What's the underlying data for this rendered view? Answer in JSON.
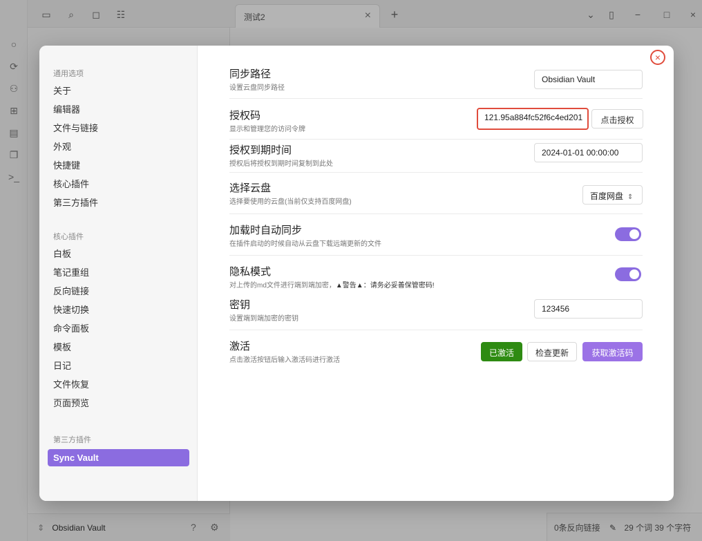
{
  "topbar": {
    "tab_title": "测试2",
    "tab_close": "×",
    "new_tab": "+",
    "doc_title": "测试2"
  },
  "status": {
    "vault_name": "Obsidian Vault",
    "backlinks": "0条反向链接",
    "words": "29 个词",
    "chars": "39 个字符"
  },
  "nav": {
    "general_header": "通用选项",
    "general_items": [
      "关于",
      "编辑器",
      "文件与链接",
      "外观",
      "快捷键",
      "核心插件",
      "第三方插件"
    ],
    "core_header": "核心插件",
    "core_items": [
      "白板",
      "笔记重组",
      "反向链接",
      "快速切换",
      "命令面板",
      "模板",
      "日记",
      "文件恢复",
      "页面预览"
    ],
    "third_header": "第三方插件",
    "third_items": [
      "Sync Vault"
    ]
  },
  "modal": {
    "close_icon": "×"
  },
  "settings": {
    "sync_path": {
      "name": "同步路径",
      "desc": "设置云盘同步路径",
      "value": "Obsidian Vault"
    },
    "auth_code": {
      "name": "授权码",
      "desc": "显示和管理您的访问令牌",
      "value": "121.95a884fc52f6c4ed201",
      "button": "点击授权"
    },
    "auth_expire": {
      "name": "授权到期时间",
      "desc": "授权后将授权到期时间复制到此处",
      "value": "2024-01-01 00:00:00"
    },
    "cloud": {
      "name": "选择云盘",
      "desc": "选择要使用的云盘(当前仅支持百度网盘)",
      "value": "百度网盘"
    },
    "auto_sync": {
      "name": "加载时自动同步",
      "desc": "在插件启动的时候自动从云盘下载远端更新的文件",
      "enabled": true
    },
    "privacy": {
      "name": "隐私模式",
      "desc_prefix": "对上传的md文件进行端到端加密，",
      "desc_warn": "▲警告▲：请务必妥善保管密码!",
      "enabled": true
    },
    "secret": {
      "name": "密钥",
      "desc": "设置端到端加密的密钥",
      "value": "123456"
    },
    "activate": {
      "name": "激活",
      "desc": "点击激活按钮后输入激活码进行激活",
      "btn_activated": "已激活",
      "btn_check": "检查更新",
      "btn_get_code": "获取激活码"
    }
  }
}
